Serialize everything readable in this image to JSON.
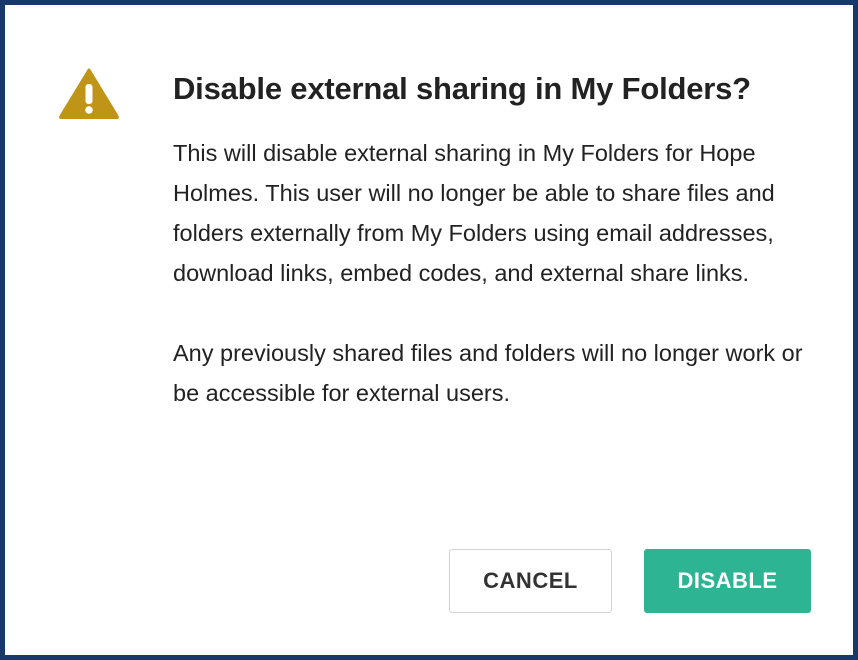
{
  "dialog": {
    "title": "Disable external sharing in My Folders?",
    "paragraphs": [
      "This will disable external sharing in My Folders for Hope Holmes. This user will no longer be able to share files and folders externally from My Folders using email addresses, download links, embed codes, and external share links.",
      "Any previously shared files and folders will no longer work or be accessible for external users."
    ],
    "icon": "warning-triangle-icon",
    "cancel_label": "CANCEL",
    "confirm_label": "DISABLE"
  },
  "colors": {
    "frame_border": "#16386b",
    "warning": "#c09517",
    "confirm_button": "#2db493"
  }
}
